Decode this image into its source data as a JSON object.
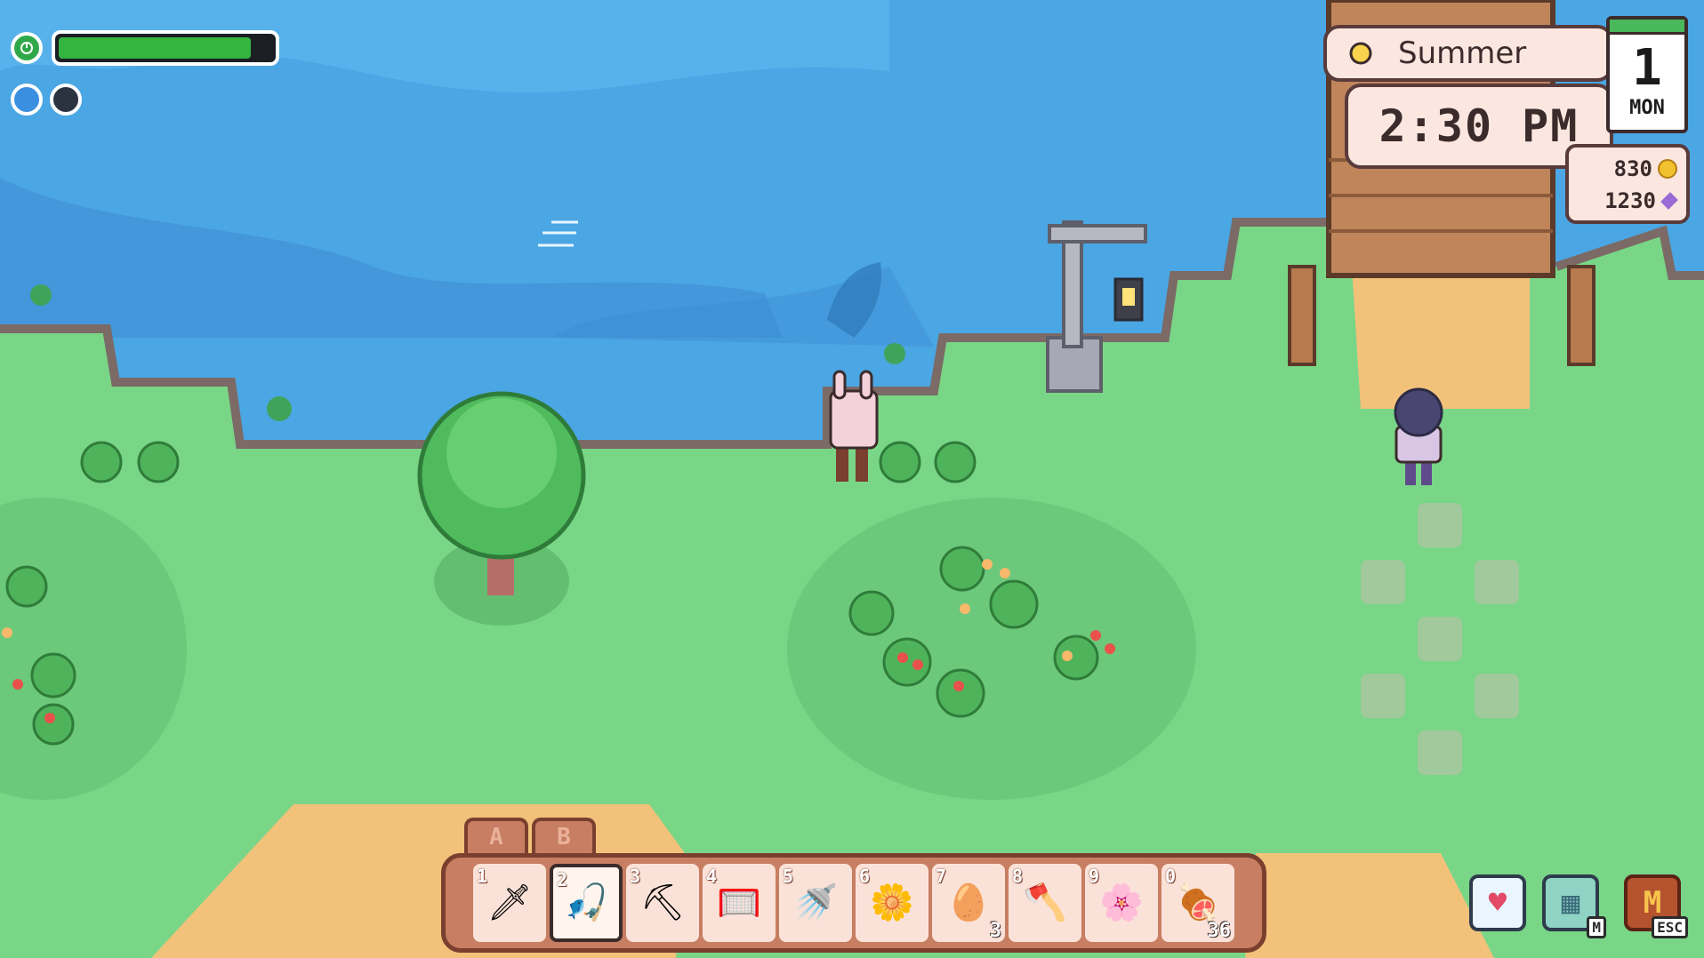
{
  "hud": {
    "energy_fraction": 0.87,
    "energy_icon": "energy-icon",
    "buffs": [
      "water-drop-icon",
      "moon-icon"
    ]
  },
  "clock": {
    "season": "Summer",
    "time": "2:30 PM",
    "day": "1",
    "weekday": "MON",
    "gold": "830",
    "gems": "1230"
  },
  "hotbar": {
    "tabs": [
      "A",
      "B"
    ],
    "selected_index": 1,
    "slots": [
      {
        "key": "1",
        "icon": "sword-icon",
        "glyph": "🗡",
        "count": ""
      },
      {
        "key": "2",
        "icon": "fishing-rod-icon",
        "glyph": "🎣",
        "count": ""
      },
      {
        "key": "3",
        "icon": "pickaxe-icon",
        "glyph": "⛏",
        "count": ""
      },
      {
        "key": "4",
        "icon": "net-icon",
        "glyph": "🥅",
        "count": ""
      },
      {
        "key": "5",
        "icon": "watering-can-icon",
        "glyph": "🚿",
        "count": ""
      },
      {
        "key": "6",
        "icon": "daisy-seed-icon",
        "glyph": "🌼",
        "count": ""
      },
      {
        "key": "7",
        "icon": "egg-icon",
        "glyph": "🥚",
        "count": "3"
      },
      {
        "key": "8",
        "icon": "axe-icon",
        "glyph": "🪓",
        "count": ""
      },
      {
        "key": "9",
        "icon": "blue-flower-icon",
        "glyph": "🌸",
        "count": ""
      },
      {
        "key": "0",
        "icon": "meat-icon",
        "glyph": "🍖",
        "count": "36"
      }
    ]
  },
  "menu_buttons": [
    {
      "name": "relationships-button",
      "icon": "heart-icon",
      "glyph": "♥",
      "hint": ""
    },
    {
      "name": "map-button",
      "icon": "map-icon",
      "glyph": "▦",
      "hint": "M"
    },
    {
      "name": "journal-button",
      "icon": "journal-icon",
      "glyph": "M",
      "hint": "ESC"
    }
  ],
  "colors": {
    "water": "#4aa3e2",
    "water_deep": "#3e8ed5",
    "grass": "#79d687",
    "sand": "#f2c17a",
    "wood": "#c0855b"
  }
}
